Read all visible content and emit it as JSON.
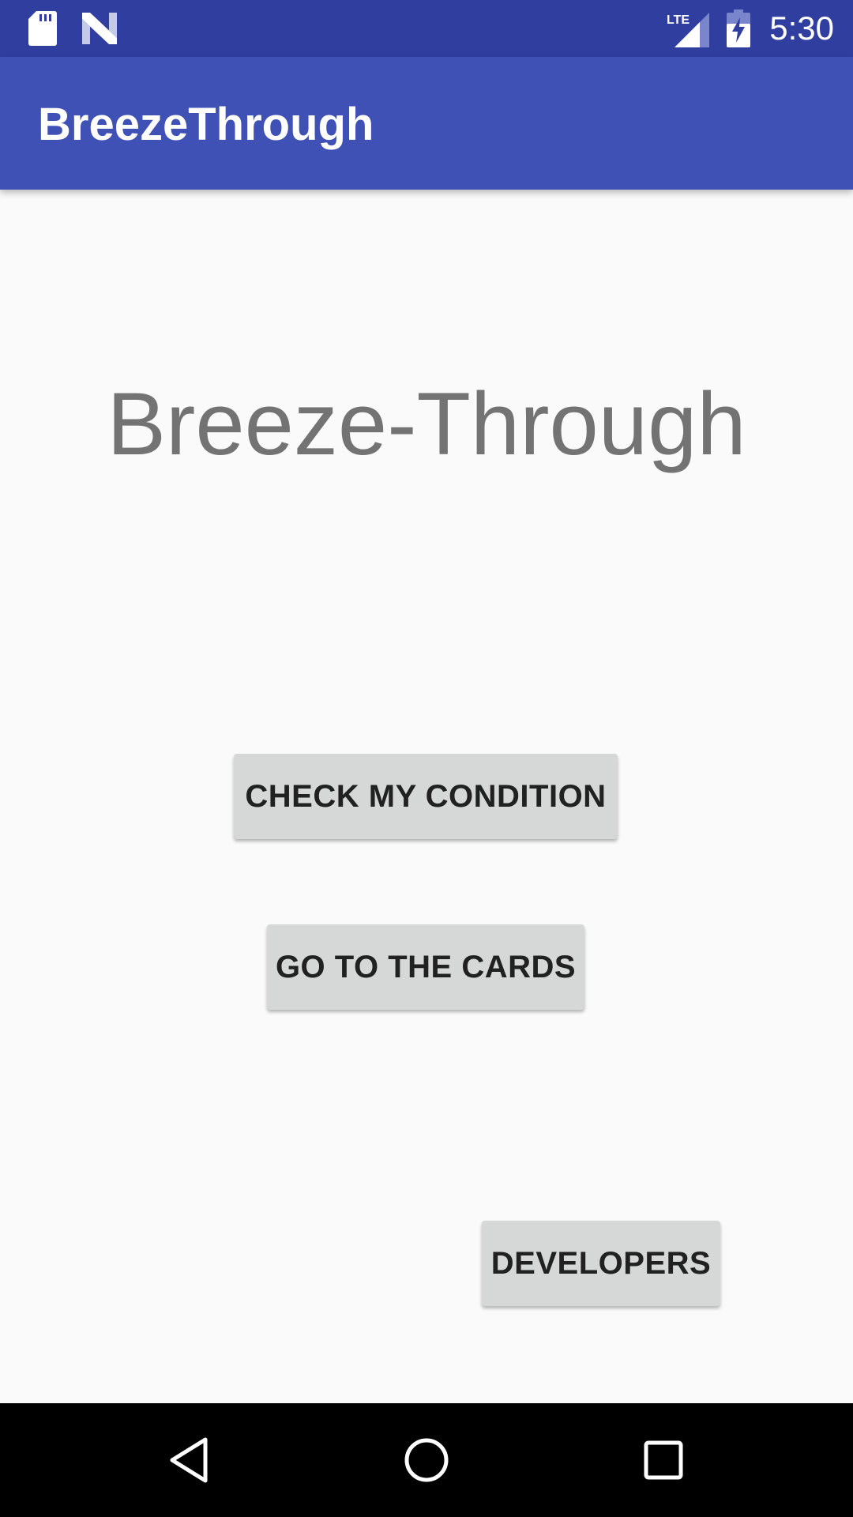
{
  "status_bar": {
    "time": "5:30",
    "icons": [
      "sd-card-icon",
      "n-logo-icon",
      "lte-signal-icon",
      "battery-charging-icon"
    ],
    "network_label": "LTE"
  },
  "app_bar": {
    "title": "BreezeThrough"
  },
  "main": {
    "headline": "Breeze-Through",
    "buttons": {
      "check_condition": "CHECK MY CONDITION",
      "go_to_cards": "GO TO THE CARDS",
      "developers": "DEVELOPERS"
    }
  },
  "nav_bar": {
    "icons": [
      "back-icon",
      "home-icon",
      "recents-icon"
    ]
  },
  "colors": {
    "status_bar": "#303f9f",
    "app_bar": "#3f51b5",
    "background": "#fafafa",
    "button": "#d6d7d7",
    "headline_text": "#737373"
  }
}
